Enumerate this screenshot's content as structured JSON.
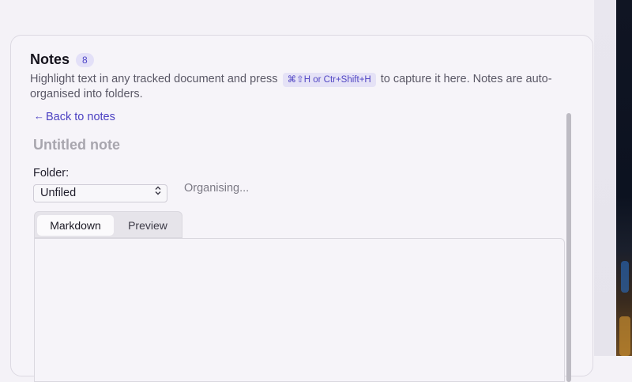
{
  "panel": {
    "title": "Notes",
    "count": "8",
    "description_part1": "Highlight text in any tracked document and press",
    "shortcut": "⌘⇧H or Ctr+Shift+H",
    "description_part2": "to capture it here. Notes are auto-organised into folders."
  },
  "editor": {
    "back_label": "Back to notes",
    "back_icon": "arrow-left-icon",
    "note_title_placeholder": "Untitled note",
    "folder_label": "Folder:",
    "folder_selected": "Unfiled",
    "status": "Organising...",
    "tabs": [
      {
        "label": "Markdown",
        "active": true
      },
      {
        "label": "Preview",
        "active": false
      }
    ]
  },
  "colors": {
    "accent": "#4b40c2",
    "badge_bg": "#e3e0f8"
  }
}
